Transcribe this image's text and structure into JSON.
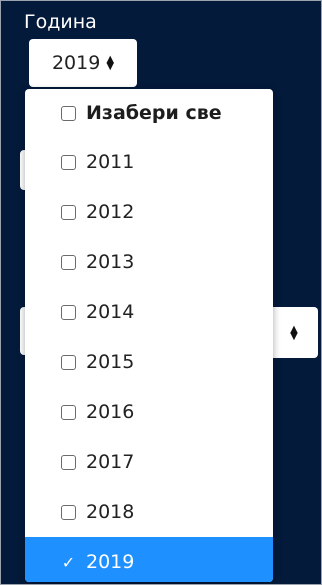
{
  "year_filter": {
    "label": "Година",
    "selected_value": "2019",
    "dropdown": {
      "select_all_label": "Изабери све",
      "options": [
        {
          "label": "2011",
          "checked": false
        },
        {
          "label": "2012",
          "checked": false
        },
        {
          "label": "2013",
          "checked": false
        },
        {
          "label": "2014",
          "checked": false
        },
        {
          "label": "2015",
          "checked": false
        },
        {
          "label": "2016",
          "checked": false
        },
        {
          "label": "2017",
          "checked": false
        },
        {
          "label": "2018",
          "checked": false
        },
        {
          "label": "2019",
          "checked": true
        }
      ]
    }
  },
  "colors": {
    "background": "#041a3b",
    "selected": "#1e90ff"
  },
  "icons": {
    "select_caret": "sort-caret-icon",
    "unchecked": "checkbox-icon",
    "checked": "checkmark-icon"
  }
}
